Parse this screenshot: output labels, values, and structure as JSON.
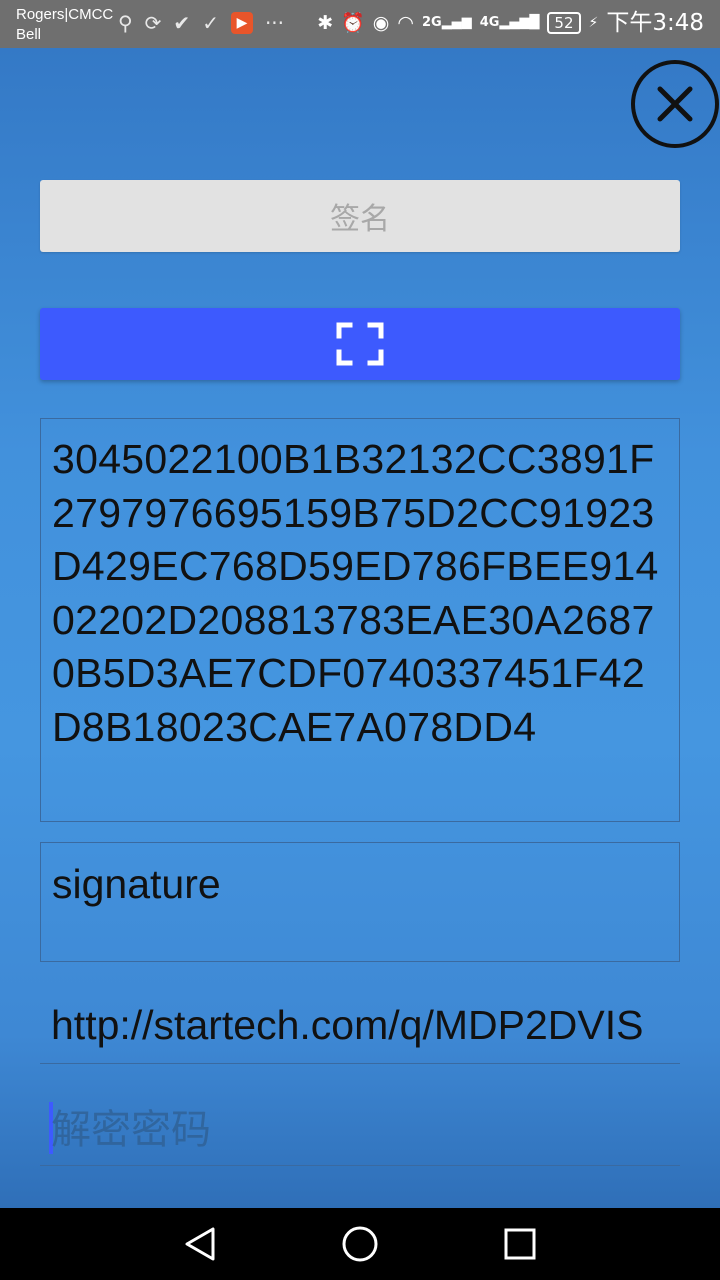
{
  "status_bar": {
    "carrier_line1": "Rogers|CMCC",
    "carrier_line2": "Bell",
    "icons_left": [
      "usb-icon",
      "sync-icon",
      "check-icon",
      "download-check-icon",
      "app-notification-icon",
      "more-icon"
    ],
    "icons_right": [
      "bluetooth-icon",
      "alarm-icon",
      "eye-icon",
      "wifi-icon",
      "signal-2g-icon",
      "signal-4g-icon"
    ],
    "signal_2g_label": "2G",
    "signal_4g_label": "4G",
    "more_label": "···",
    "battery": "52",
    "time": "下午3:48"
  },
  "main": {
    "sign_button_label": "签名",
    "hex_value": "3045022100B1B32132CC3891F2797976695159B75D2CC91923D429EC768D59ED786FBEE91402202D208813783EAE30A26870B5D3AE7CDF0740337451F42D8B18023CAE7A078DD4",
    "signature_label": "signature",
    "url_value": "http://startech.com/q/MDP2DVIS",
    "password_placeholder": "解密密码"
  },
  "colors": {
    "scan_button": "#3d5afe",
    "sign_button": "#e2e2e2",
    "background": "#4596e0"
  }
}
